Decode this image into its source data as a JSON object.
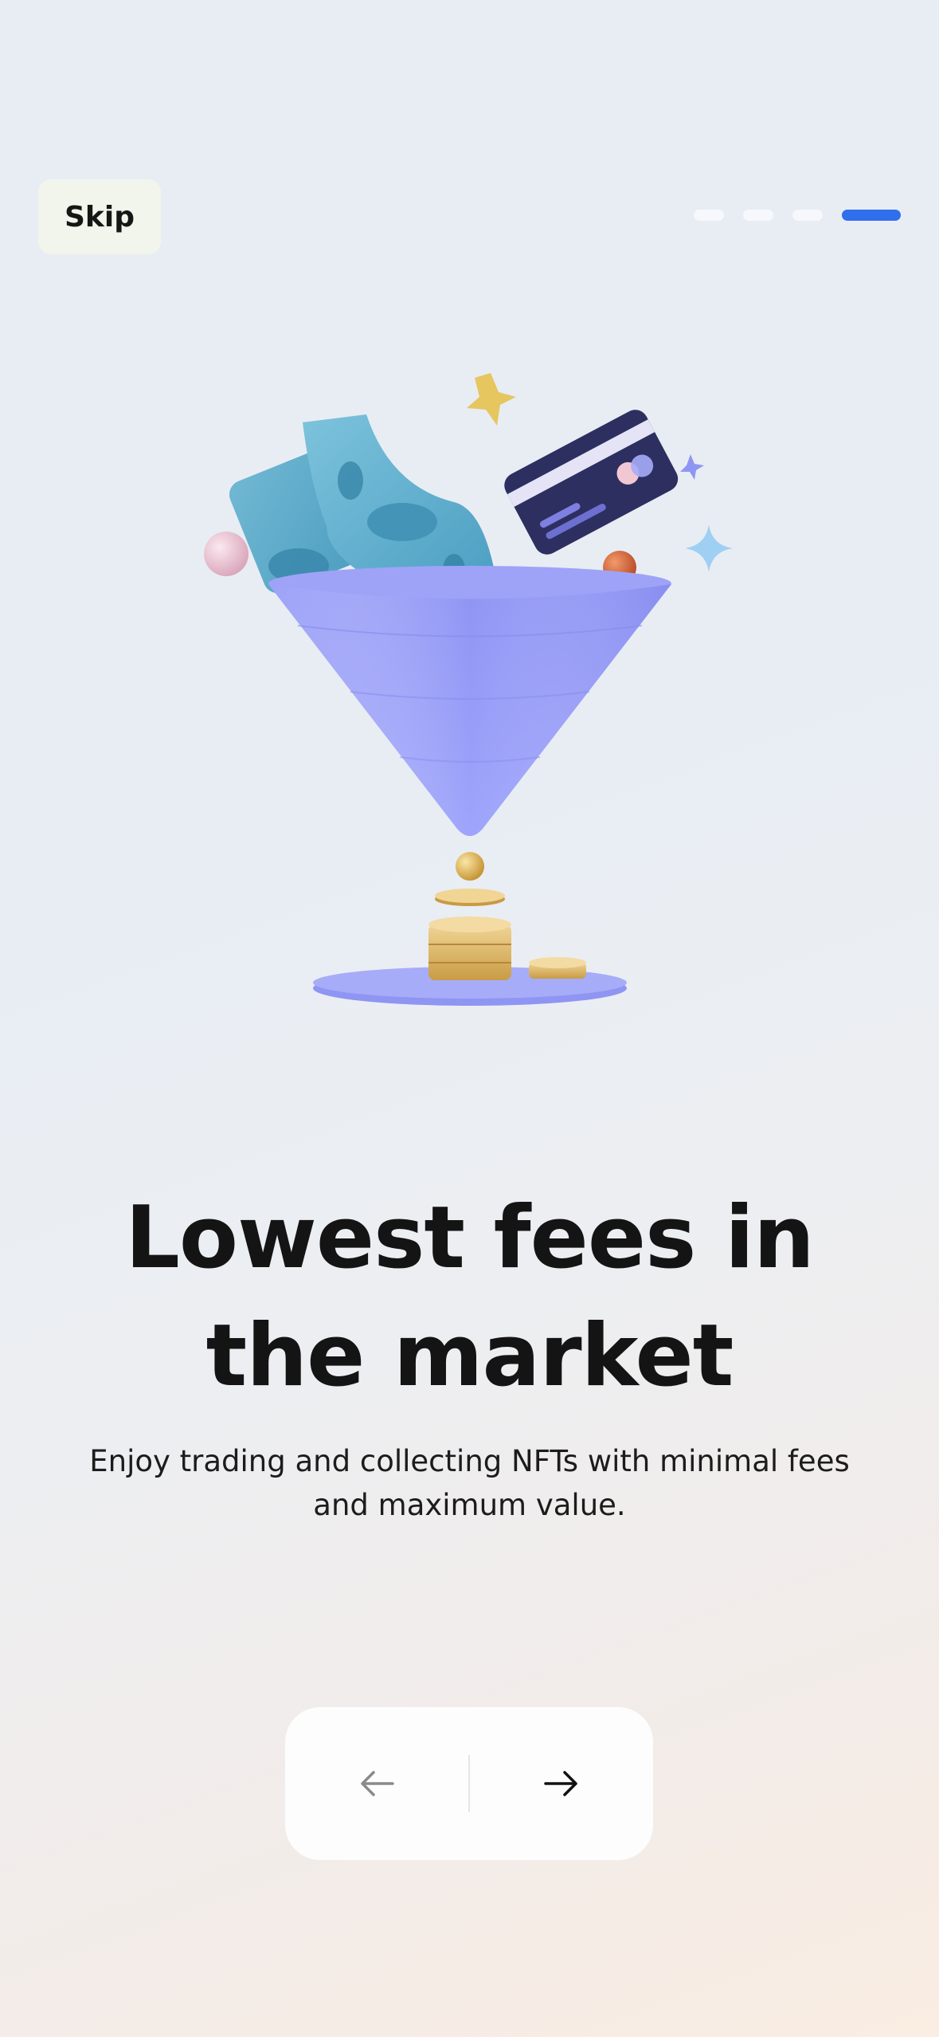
{
  "header": {
    "skip_label": "Skip",
    "pager": {
      "total": 4,
      "active_index": 3,
      "active_color": "#2f6fec"
    }
  },
  "illustration": {
    "icon": "funnel-with-money-card-coins-illustration"
  },
  "content": {
    "title_line1": "Lowest fees in",
    "title_line2": "the market",
    "subtitle_line1": "Enjoy trading and collecting NFTs with minimal fees",
    "subtitle_line2": "and maximum value."
  },
  "navigation": {
    "back_icon": "arrow-left-icon",
    "next_icon": "arrow-right-icon"
  }
}
